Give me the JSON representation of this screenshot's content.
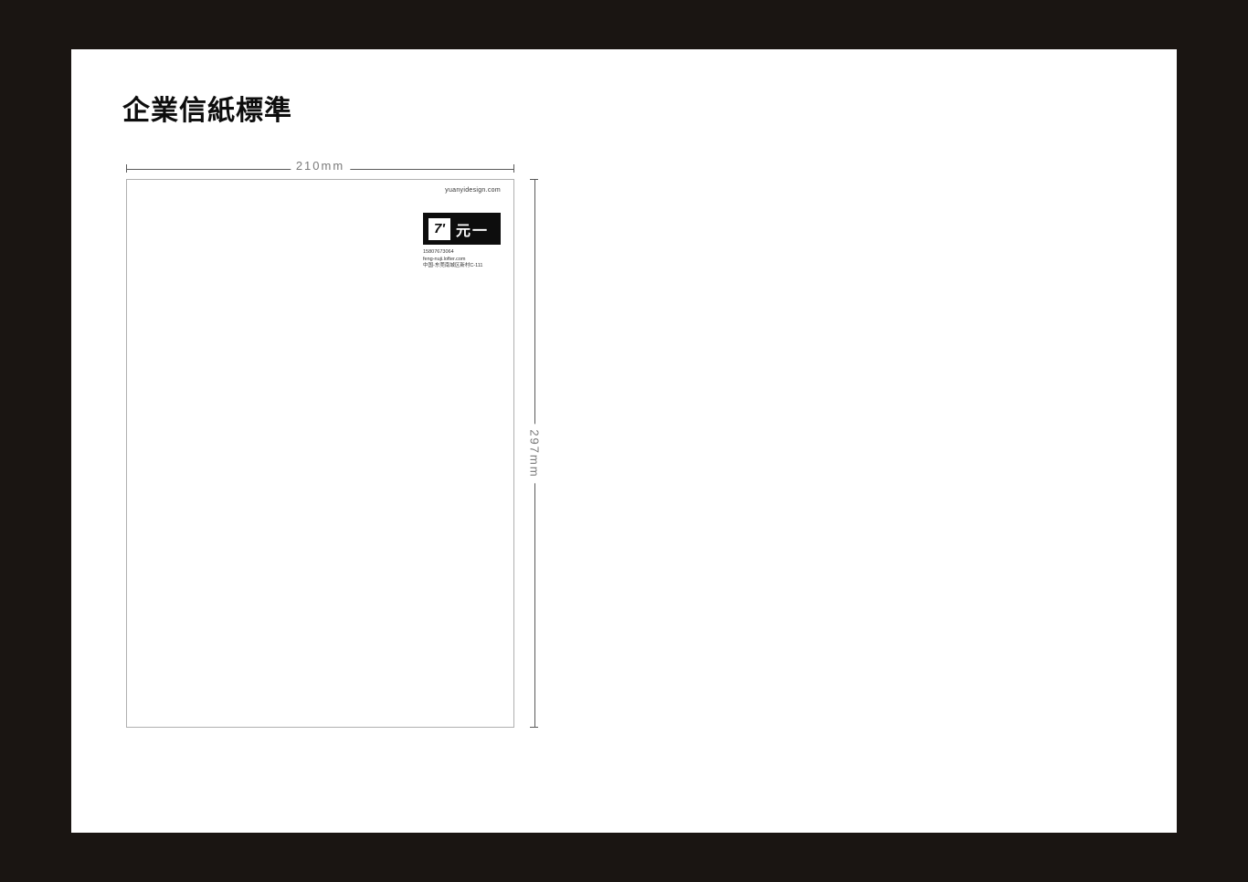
{
  "title": "企業信紙標準",
  "dimensions": {
    "width": "210mm",
    "height": "297mm"
  },
  "letterhead": {
    "url": "yuanyidesign.com",
    "logo": {
      "mark": "7'",
      "text": "元一"
    },
    "contact": {
      "line1": "15807673064",
      "line2": "feng-nuji.lofter.com",
      "line3": "中国-东莞南城区新村C-111"
    }
  }
}
